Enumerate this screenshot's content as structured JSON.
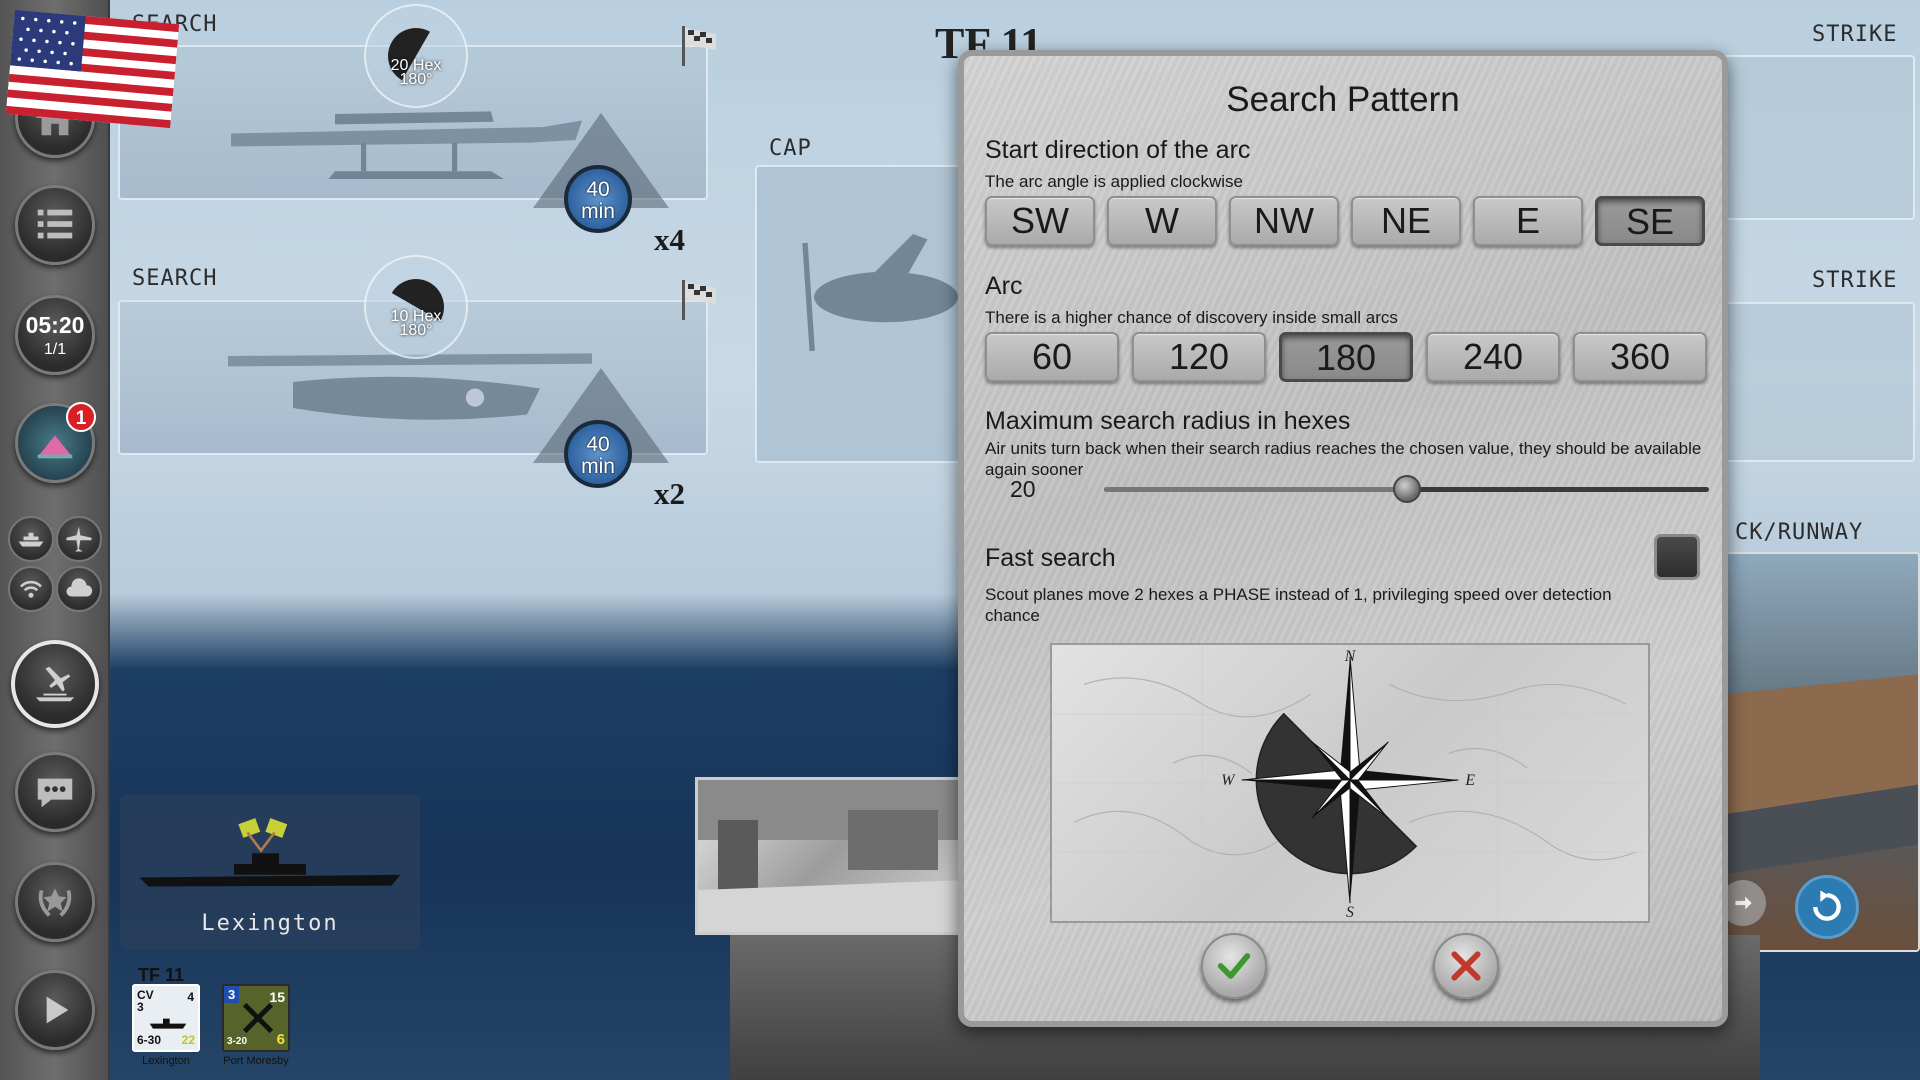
{
  "sidebar": {
    "clock": {
      "time": "05:20",
      "turn": "1/1"
    },
    "notification_count": "1",
    "icons": [
      "home-icon",
      "list-icon",
      "clock-icon",
      "base-icon",
      "ship-icon",
      "plane-icon",
      "radio-icon",
      "weather-icon",
      "air-ops-icon",
      "chat-icon",
      "medal-icon",
      "play-icon"
    ]
  },
  "header": {
    "task_force": "TF 11"
  },
  "missions": [
    {
      "label": "SEARCH",
      "radius": "20 Hex",
      "arc": "180°",
      "timer_value": "40",
      "timer_unit": "min",
      "count": "x4"
    },
    {
      "label": "SEARCH",
      "radius": "10 Hex",
      "arc": "180°",
      "timer_value": "40",
      "timer_unit": "min",
      "count": "x2"
    }
  ],
  "cap": {
    "label": "CAP"
  },
  "right_panels": {
    "strike_1": "STRIKE",
    "strike_2": "STRIKE",
    "deck": "CK/RUNWAY"
  },
  "ship": {
    "name": "Lexington"
  },
  "units": {
    "task_force": "TF 11",
    "items": [
      {
        "name": "Lexington",
        "type": "CV",
        "top_left": "3",
        "top_right": "4",
        "bottom_left": "6-30",
        "bottom_right": "22"
      },
      {
        "name": "Port Moresby",
        "top_left": "3",
        "top_right": "15",
        "bottom_left": "3-20",
        "bottom_right": "6"
      }
    ]
  },
  "dialog": {
    "title": "Search Pattern",
    "start_direction": {
      "title": "Start direction of the arc",
      "desc": "The arc angle is applied clockwise",
      "options": [
        "SW",
        "W",
        "NW",
        "NE",
        "E",
        "SE"
      ],
      "selected": "SE"
    },
    "arc": {
      "title": "Arc",
      "desc": "There is a higher chance of discovery inside small arcs",
      "options": [
        "60",
        "120",
        "180",
        "240",
        "360"
      ],
      "selected": "180"
    },
    "radius": {
      "title": "Maximum search radius in hexes",
      "desc": "Air units turn back when their search radius reaches the chosen value, they should be available again sooner",
      "value": "20",
      "slider_fraction": 0.5
    },
    "fast_search": {
      "title": "Fast search",
      "desc": "Scout planes move 2 hexes a PHASE instead of 1, privileging speed over detection chance",
      "checked": false
    },
    "compass": {
      "n": "N",
      "s": "S",
      "e": "E",
      "w": "W",
      "arc_start": "SE",
      "arc_degrees": 180
    },
    "confirm_icon": "check-icon",
    "cancel_icon": "close-icon"
  },
  "colors": {
    "timer_blue": "#3c75b3",
    "badge_red": "#d81f26",
    "confirm_green": "#3a9a2e",
    "cancel_red": "#c0392b"
  }
}
